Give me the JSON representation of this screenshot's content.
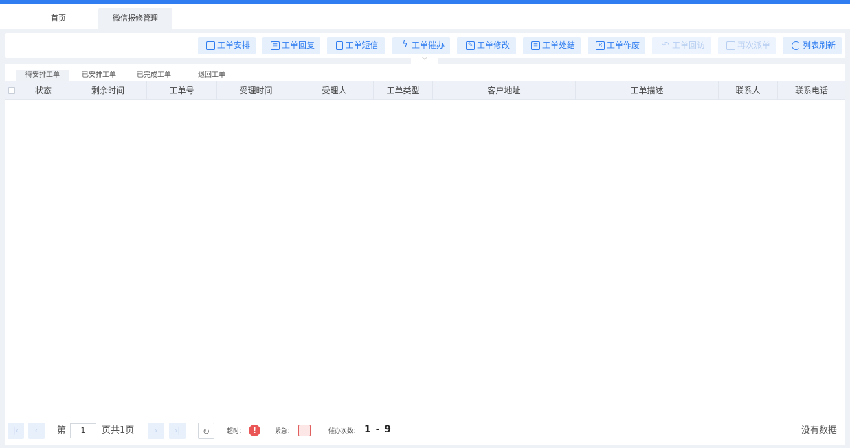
{
  "tabs": [
    {
      "label": "首页"
    },
    {
      "label": "微信报修管理"
    }
  ],
  "toolbar": {
    "buttons": [
      {
        "label": "工单安排",
        "icon": "arrange-icon"
      },
      {
        "label": "工单回复",
        "icon": "reply-icon"
      },
      {
        "label": "工单短信",
        "icon": "phone-icon"
      },
      {
        "label": "工单催办",
        "icon": "lightning-icon"
      },
      {
        "label": "工单修改",
        "icon": "edit-icon"
      },
      {
        "label": "工单处结",
        "icon": "finish-icon"
      },
      {
        "label": "工单作废",
        "icon": "void-icon"
      },
      {
        "label": "工单回访",
        "icon": "undo-icon"
      },
      {
        "label": "再次派单",
        "icon": "redispatch-icon"
      },
      {
        "label": "列表刷新",
        "icon": "refresh-icon"
      }
    ]
  },
  "subtabs": [
    {
      "label": "待安排工单"
    },
    {
      "label": "已安排工单"
    },
    {
      "label": "已完成工单"
    },
    {
      "label": "退回工单"
    }
  ],
  "table": {
    "columns": [
      "状态",
      "剩余时间",
      "工单号",
      "受理时间",
      "受理人",
      "工单类型",
      "客户地址",
      "工单描述",
      "联系人",
      "联系电话"
    ]
  },
  "pager": {
    "page_prefix": "第",
    "page_value": "1",
    "page_suffix": "页共1页",
    "overtime_label": "超时：",
    "urgent_label": "紧急：",
    "urge_count_label": "催办次数：",
    "urge_count_value": "1 - 9",
    "empty_text": "没有数据"
  },
  "colors": {
    "accent": "#2f7df0",
    "button_bg": "#e6f0fd",
    "alarm": "#ea5656"
  }
}
